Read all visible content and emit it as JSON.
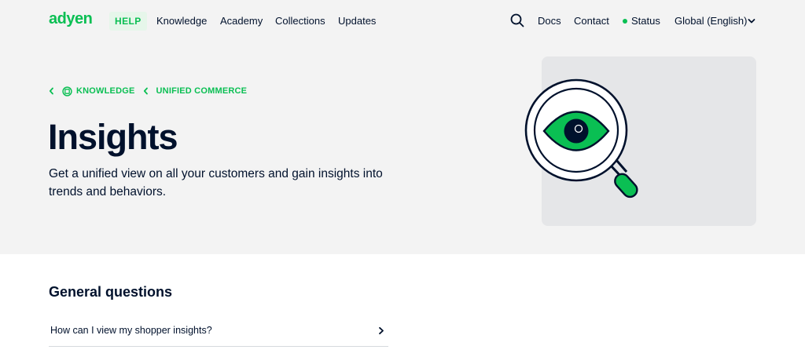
{
  "header": {
    "logo_text": "adyen",
    "help_label": "HELP",
    "nav_items": [
      "Knowledge",
      "Academy",
      "Collections",
      "Updates"
    ],
    "docs_label": "Docs",
    "contact_label": "Contact",
    "status_label": "Status",
    "language_label": "Global (English)"
  },
  "breadcrumb": {
    "items": [
      "KNOWLEDGE",
      "UNIFIED COMMERCE"
    ]
  },
  "hero": {
    "title": "Insights",
    "subtitle": "Get a unified view on all your customers and gain insights into trends and behaviors."
  },
  "general_questions": {
    "heading": "General questions",
    "items": [
      "How can I view my shopper insights?"
    ]
  },
  "colors": {
    "brand_green": "#0abf53",
    "navy": "#00112c",
    "hero_bg": "#f3f3f3"
  }
}
